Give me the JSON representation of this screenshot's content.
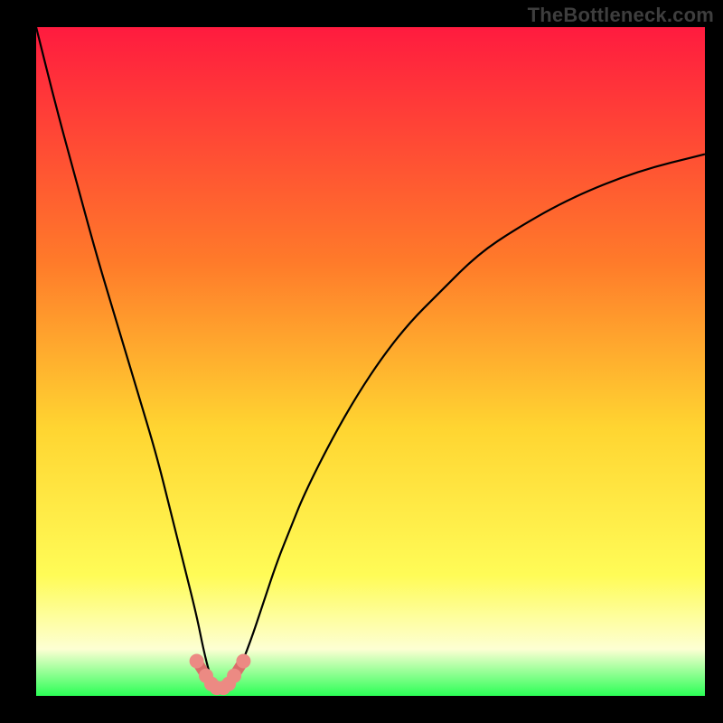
{
  "attribution": "TheBottleneck.com",
  "colors": {
    "bg_black": "#000000",
    "grad_top": "#ff1b3f",
    "grad_mid_upper": "#ff7a2a",
    "grad_mid": "#ffd531",
    "grad_mid_lower": "#fffc57",
    "grad_pale": "#fdffd3",
    "grad_green": "#2bff56",
    "curve_stroke": "#000000",
    "marker_stroke": "#d96e6a",
    "marker_fill": "#ec8a83"
  },
  "chart_data": {
    "type": "line",
    "title": "",
    "xlabel": "",
    "ylabel": "",
    "xlim": [
      0,
      100
    ],
    "ylim": [
      0,
      100
    ],
    "grid": false,
    "series": [
      {
        "name": "bottleneck-curve",
        "x": [
          0,
          3,
          6,
          9,
          12,
          15,
          18,
          20,
          22,
          24,
          25,
          26,
          27,
          28,
          29,
          30,
          32,
          34,
          36,
          38,
          40,
          44,
          48,
          52,
          56,
          60,
          66,
          72,
          80,
          90,
          100
        ],
        "values": [
          100,
          88,
          77,
          66,
          56,
          46,
          36,
          28,
          20,
          12,
          7,
          3,
          1,
          0.5,
          1,
          3,
          8,
          14,
          20,
          25,
          30,
          38,
          45,
          51,
          56,
          60,
          66,
          70,
          74.5,
          78.5,
          81
        ]
      }
    ],
    "markers": {
      "name": "highlighted-minimum",
      "x": [
        24.0,
        25.4,
        26.2,
        27.0,
        28.0,
        28.8,
        29.6,
        31.0
      ],
      "y": [
        5.2,
        3.0,
        1.8,
        1.2,
        1.2,
        1.8,
        3.0,
        5.2
      ]
    }
  }
}
